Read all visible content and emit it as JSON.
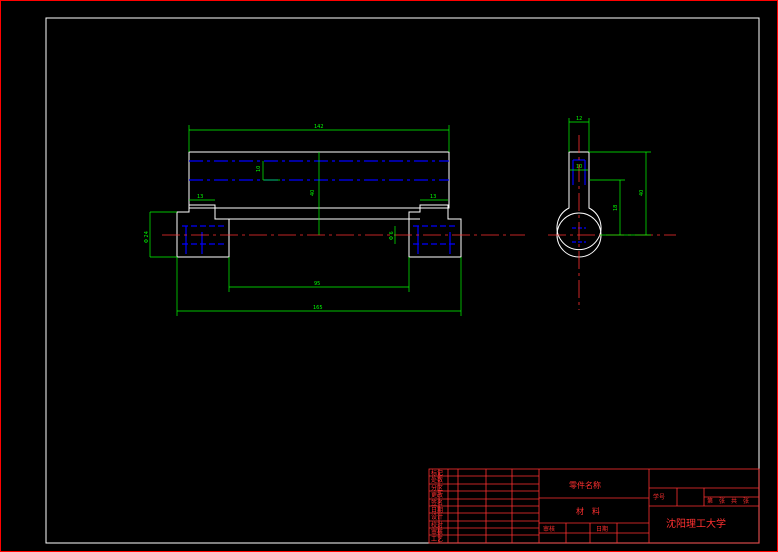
{
  "colors": {
    "background": "#000000",
    "border": "#ff0000",
    "object_line": "#ffffff",
    "dimension": "#00ff00",
    "hidden_line": "#0000ff",
    "center_line": "#ff3030",
    "title_block": "#ff3030"
  },
  "front_view": {
    "dim_overall_top": "142",
    "dim_height_total": "40",
    "dim_slot_depth": "10",
    "dim_left_offset": "13",
    "dim_right_offset": "13",
    "dim_left_dia": "Φ 24",
    "dim_right_dia": "Φ 6",
    "dim_inner_span": "95",
    "dim_overall_bottom": "165"
  },
  "side_view": {
    "dim_top_width": "12",
    "dim_slot": "10",
    "dim_height_a": "18",
    "dim_height_b": "40"
  },
  "title_block": {
    "part_name_label": "零件名称",
    "material_label": "材　料",
    "serial_label": "学号",
    "sheet_label": "第　张　共　张",
    "school": "沈阳理工大学",
    "review_label": "审核",
    "date_label": "日期",
    "row_labels": [
      "标记",
      "处数",
      "分区",
      "更改",
      "签名",
      "日期",
      "设计",
      "校对",
      "审核",
      "工艺"
    ]
  }
}
